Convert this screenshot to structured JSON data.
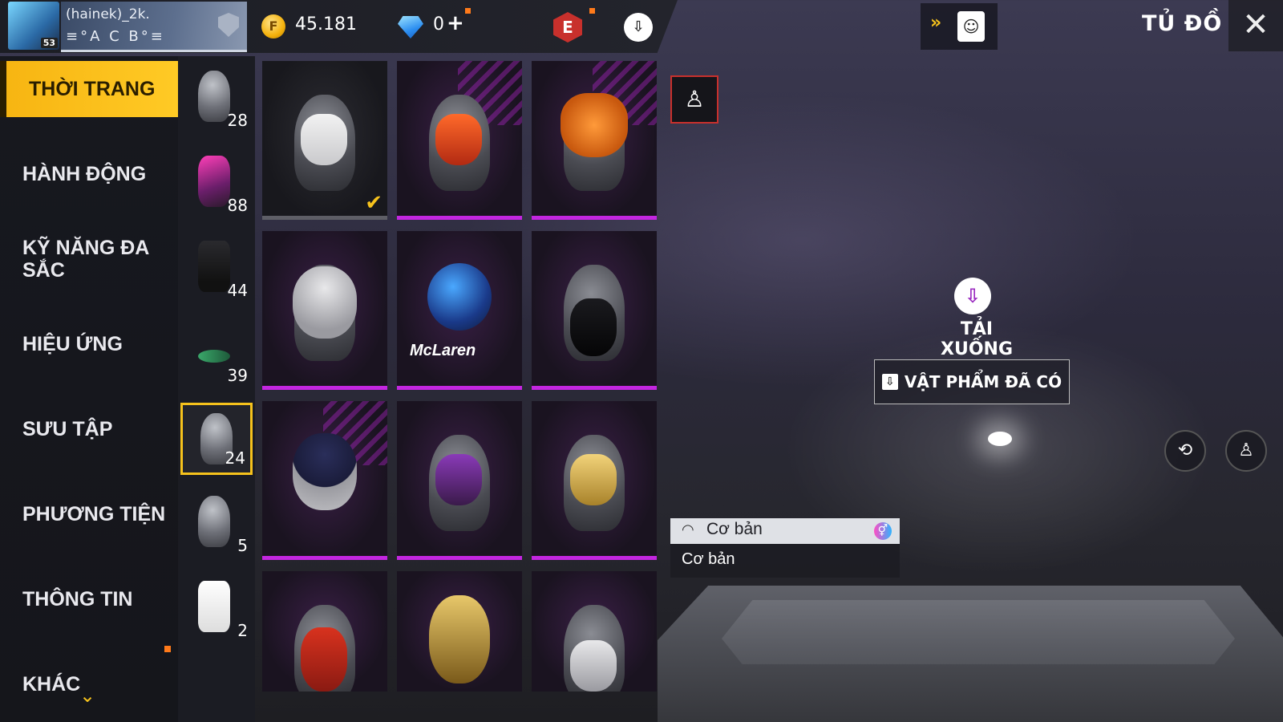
{
  "player": {
    "name": "(hainek)_2k.",
    "tag": "≡°A C B°≡",
    "level": "53"
  },
  "currency": {
    "coins": "45.181",
    "coin_symbol": "F",
    "diamonds": "0",
    "add": "+"
  },
  "top_right": {
    "title": "TỦ ĐỒ",
    "close": "✕"
  },
  "categories": [
    {
      "label": "THỜI TRANG"
    },
    {
      "label": "HÀNH ĐỘNG"
    },
    {
      "label": "KỸ NĂNG ĐA SẮC"
    },
    {
      "label": "HIỆU ỨNG"
    },
    {
      "label": "SƯU TẬP"
    },
    {
      "label": "PHƯƠNG TIỆN"
    },
    {
      "label": "THÔNG TIN"
    },
    {
      "label": "KHÁC"
    }
  ],
  "subcategories": [
    {
      "count": "28"
    },
    {
      "count": "88"
    },
    {
      "count": "44"
    },
    {
      "count": "39"
    },
    {
      "count": "24"
    },
    {
      "count": "5"
    },
    {
      "count": "2"
    }
  ],
  "items_brand": "McLaren",
  "download": {
    "label": "TẢI XUỐNG"
  },
  "owned_button": {
    "label": "VẬT PHẨM ĐÃ CÓ"
  },
  "info": {
    "title": "Cơ bản",
    "subtitle": "Cơ bản"
  },
  "colors": {
    "accent": "#f6c21c",
    "purple": "#c326e0",
    "red": "#c8302c"
  },
  "icons": {
    "coin": "coin-icon",
    "diamond": "diamond-icon",
    "e_badge": "e-badge-icon",
    "cloud": "cloud-download-icon",
    "mannequin": "mannequin-icon",
    "close": "close-icon"
  }
}
